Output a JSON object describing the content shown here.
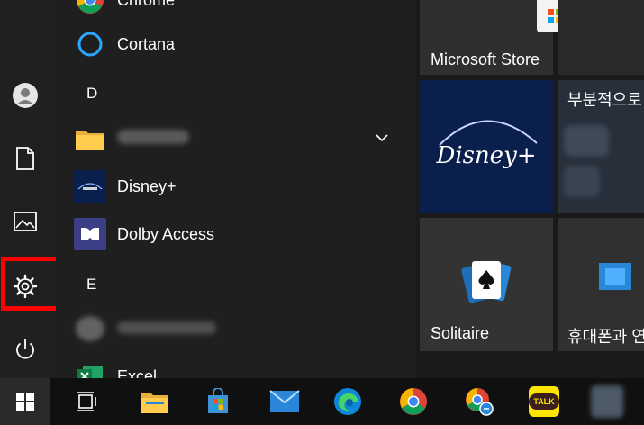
{
  "app_list": {
    "items": [
      {
        "label": "Chrome"
      },
      {
        "label": "Cortana"
      },
      {
        "label": "D"
      },
      {
        "label": ""
      },
      {
        "label": "Disney+"
      },
      {
        "label": "Dolby Access"
      },
      {
        "label": "E"
      },
      {
        "label": ""
      },
      {
        "label": "Excel"
      }
    ]
  },
  "tiles": {
    "microsoft_store": {
      "label": "Microsoft Store"
    },
    "partial_kr": {
      "label": "부분적으로"
    },
    "solitaire": {
      "label": "Solitaire"
    },
    "phone_kr": {
      "label": "휴대폰과 연"
    },
    "disney_logo_text": "Disney+"
  },
  "taskbar": {
    "kakaotalk_text": "TALK"
  },
  "colors": {
    "highlight": "#ff0000",
    "accent_blue": "#0078d7",
    "disney_bg": "#0b1f4d"
  }
}
